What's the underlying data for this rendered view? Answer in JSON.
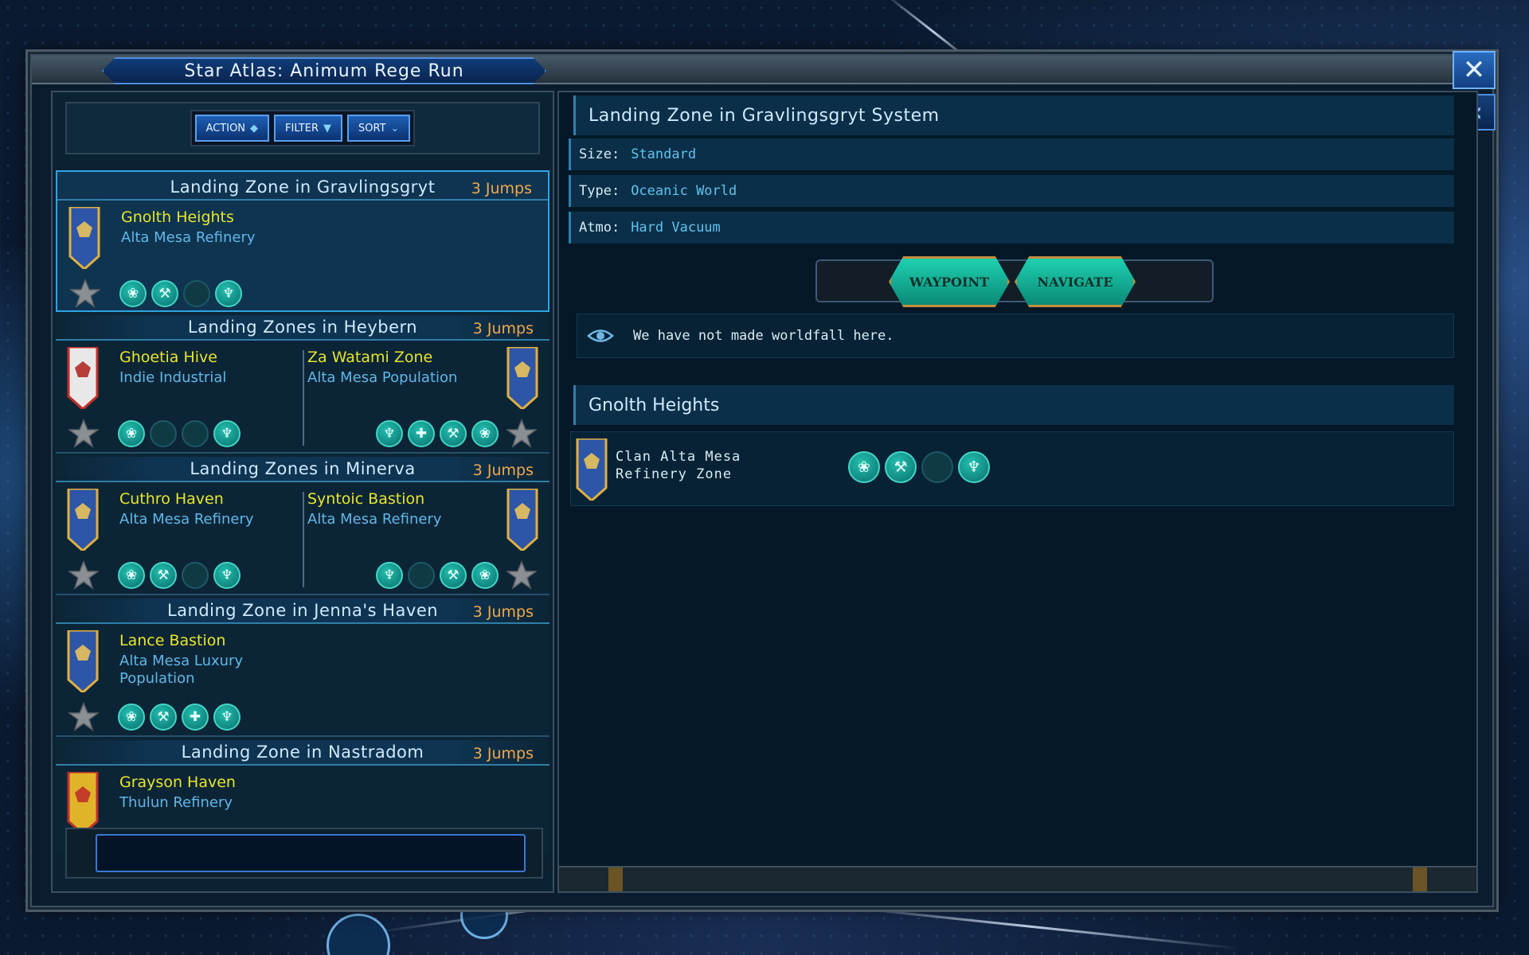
{
  "window": {
    "title": "Star Atlas: Animum Rege Run",
    "close_glyph": "✕",
    "collapse_glyph": "«"
  },
  "toolbar": {
    "action_label": "ACTION",
    "filter_label": "FILTER",
    "sort_label": "SORT",
    "action_icon": "◆",
    "filter_icon": "▼",
    "sort_icon": "⌄"
  },
  "groups": [
    {
      "title": "Landing Zone in Gravlingsgryt",
      "jumps": "3 Jumps",
      "zones": [
        {
          "name": "Gnolth Heights",
          "faction": "Alta Mesa Refinery",
          "banner": "blue",
          "resources": [
            {
              "icon": "tri-circle-icon",
              "glyph": "❀"
            },
            {
              "icon": "wrench-icon",
              "glyph": "⚒"
            },
            {
              "icon": "empty",
              "glyph": ""
            },
            {
              "icon": "crystal-icon",
              "glyph": "♆"
            }
          ]
        }
      ]
    },
    {
      "title": "Landing Zones in Heybern",
      "jumps": "3 Jumps",
      "zones": [
        {
          "name": "Ghoetia Hive",
          "faction": "Indie Industrial",
          "banner": "red-white",
          "resources": [
            {
              "icon": "tri-circle-icon",
              "glyph": "❀"
            },
            {
              "icon": "empty",
              "glyph": ""
            },
            {
              "icon": "empty",
              "glyph": ""
            },
            {
              "icon": "crystal-icon",
              "glyph": "♆"
            }
          ]
        },
        {
          "name": "Za Watami Zone",
          "faction": "Alta Mesa Population",
          "banner": "blue",
          "resources": [
            {
              "icon": "crystal-icon",
              "glyph": "♆"
            },
            {
              "icon": "bandage-icon",
              "glyph": "✚"
            },
            {
              "icon": "wrench-icon",
              "glyph": "⚒"
            },
            {
              "icon": "tri-circle-icon",
              "glyph": "❀"
            }
          ]
        }
      ]
    },
    {
      "title": "Landing Zones in Minerva",
      "jumps": "3 Jumps",
      "zones": [
        {
          "name": "Cuthro Haven",
          "faction": "Alta Mesa Refinery",
          "banner": "blue",
          "resources": [
            {
              "icon": "tri-circle-icon",
              "glyph": "❀"
            },
            {
              "icon": "wrench-icon",
              "glyph": "⚒"
            },
            {
              "icon": "empty",
              "glyph": ""
            },
            {
              "icon": "crystal-icon",
              "glyph": "♆"
            }
          ]
        },
        {
          "name": "Syntoic Bastion",
          "faction": "Alta Mesa Refinery",
          "banner": "blue",
          "resources": [
            {
              "icon": "crystal-icon",
              "glyph": "♆"
            },
            {
              "icon": "empty",
              "glyph": ""
            },
            {
              "icon": "wrench-icon",
              "glyph": "⚒"
            },
            {
              "icon": "tri-circle-icon",
              "glyph": "❀"
            }
          ]
        }
      ]
    },
    {
      "title": "Landing Zone in Jenna's Haven",
      "jumps": "3 Jumps",
      "zones": [
        {
          "name": "Lance Bastion",
          "faction": "Alta Mesa Luxury Population",
          "banner": "blue",
          "resources": [
            {
              "icon": "tri-circle-icon",
              "glyph": "❀"
            },
            {
              "icon": "wrench-icon",
              "glyph": "⚒"
            },
            {
              "icon": "bandage-icon",
              "glyph": "✚"
            },
            {
              "icon": "crystal-icon",
              "glyph": "♆"
            }
          ]
        }
      ]
    },
    {
      "title": "Landing Zone in Nastradom",
      "jumps": "3 Jumps",
      "zones": [
        {
          "name": "Grayson Haven",
          "faction": "Thulun Refinery",
          "banner": "red-yellow",
          "resources": [
            {
              "icon": "tri-circle-icon",
              "glyph": "❀"
            },
            {
              "icon": "wrench-icon",
              "glyph": "⚒"
            },
            {
              "icon": "bandage-icon",
              "glyph": "✚"
            },
            {
              "icon": "crystal-icon",
              "glyph": "♆"
            }
          ]
        }
      ]
    }
  ],
  "selected_group_index": 0,
  "name_input": {
    "value": ""
  },
  "detail": {
    "title": "Landing Zone in Gravlingsgryt System",
    "size_key": "Size:",
    "size_value": "Standard",
    "type_key": "Type:",
    "type_value": "Oceanic World",
    "atmo_key": "Atmo:",
    "atmo_value": "Hard Vacuum",
    "waypoint_label": "WAYPOINT",
    "navigate_label": "NAVIGATE",
    "note": "We have not made worldfall here.",
    "zone_title": "Gnolth Heights",
    "zone_faction": "Clan Alta Mesa Refinery Zone",
    "zone_resources": [
      {
        "icon": "tri-circle-icon",
        "glyph": "❀"
      },
      {
        "icon": "wrench-icon",
        "glyph": "⚒"
      },
      {
        "icon": "empty",
        "glyph": ""
      },
      {
        "icon": "crystal-icon",
        "glyph": "♆"
      }
    ]
  },
  "colors": {
    "zone_name": "#e7e62c",
    "faction": "#5fb7e8",
    "jumps": "#f0a94a",
    "accent": "#2fa3e4",
    "resource": "#23c0b0"
  }
}
